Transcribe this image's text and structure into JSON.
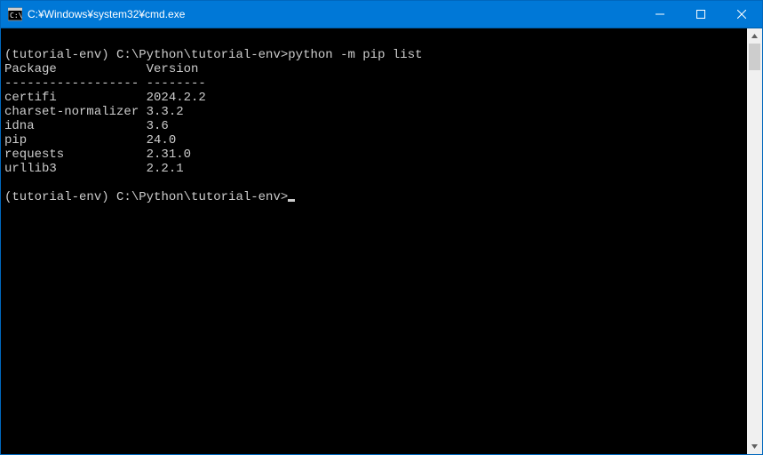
{
  "window": {
    "title": "C:¥Windows¥system32¥cmd.exe"
  },
  "terminal": {
    "prompt_env": "(tutorial-env)",
    "prompt_path": "C:\\Python\\tutorial-env>",
    "command": "python -m pip list",
    "header_package": "Package",
    "header_version": "Version",
    "divider_package": "------------------",
    "divider_version": "--------",
    "packages": [
      {
        "name": "certifi",
        "version": "2024.2.2"
      },
      {
        "name": "charset-normalizer",
        "version": "3.3.2"
      },
      {
        "name": "idna",
        "version": "3.6"
      },
      {
        "name": "pip",
        "version": "24.0"
      },
      {
        "name": "requests",
        "version": "2.31.0"
      },
      {
        "name": "urllib3",
        "version": "2.2.1"
      }
    ]
  }
}
